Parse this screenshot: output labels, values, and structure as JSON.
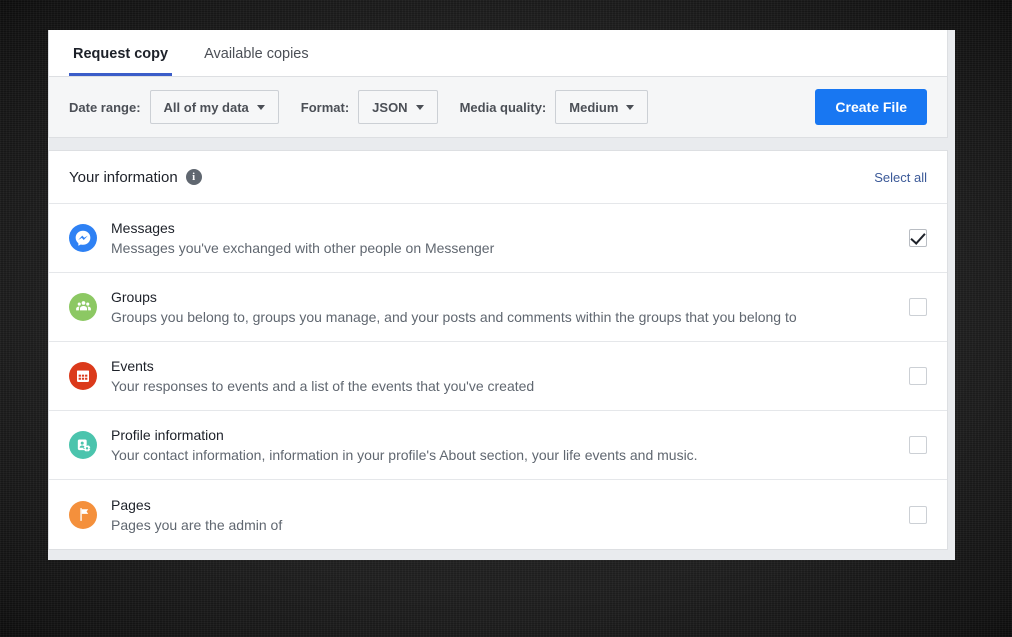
{
  "tabs": [
    {
      "label": "Request copy",
      "active": true
    },
    {
      "label": "Available copies",
      "active": false
    }
  ],
  "toolbar": {
    "date_range_label": "Date range:",
    "date_range_value": "All of my data",
    "format_label": "Format:",
    "format_value": "JSON",
    "media_quality_label": "Media quality:",
    "media_quality_value": "Medium",
    "create_file_label": "Create File"
  },
  "info": {
    "title": "Your information",
    "info_icon_glyph": "i",
    "select_all_label": "Select all"
  },
  "rows": [
    {
      "icon": "messenger-icon",
      "icon_color": "#2e81f4",
      "title": "Messages",
      "desc": "Messages you've exchanged with other people on Messenger",
      "checked": true
    },
    {
      "icon": "groups-icon",
      "icon_color": "#8cc863",
      "title": "Groups",
      "desc": "Groups you belong to, groups you manage, and your posts and comments within the groups that you belong to",
      "checked": false
    },
    {
      "icon": "events-calendar-icon",
      "icon_color": "#db3a1b",
      "title": "Events",
      "desc": "Your responses to events and a list of the events that you've created",
      "checked": false
    },
    {
      "icon": "profile-gear-icon",
      "icon_color": "#4bc4ad",
      "title": "Profile information",
      "desc": "Your contact information, information in your profile's About section, your life events and music.",
      "checked": false
    },
    {
      "icon": "pages-flag-icon",
      "icon_color": "#f4903c",
      "title": "Pages",
      "desc": "Pages you are the admin of",
      "checked": false
    }
  ],
  "colors": {
    "accent_blue": "#1877f2",
    "link_blue": "#3b5998",
    "tab_underline": "#3b5dc9",
    "page_background": "#e9ebee"
  }
}
